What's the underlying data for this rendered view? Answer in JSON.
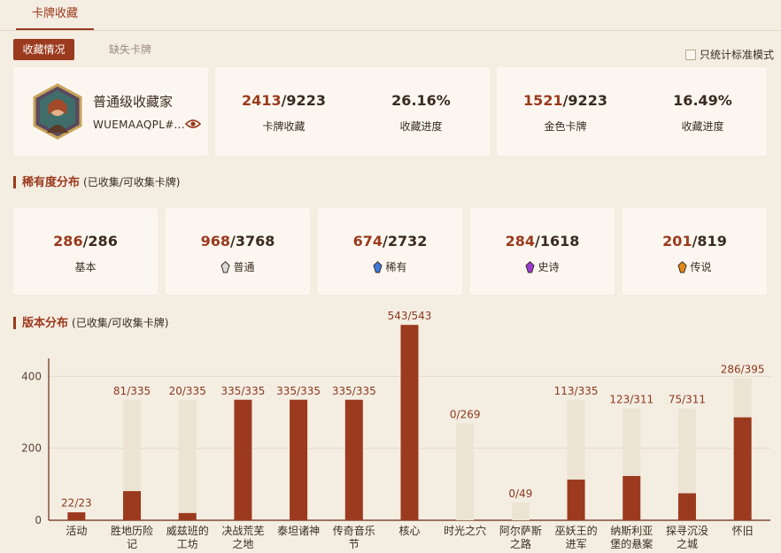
{
  "tabs": {
    "main": "卡牌收藏"
  },
  "subtabs": {
    "active": "收藏情况",
    "other": "缺失卡牌"
  },
  "std_mode_label": "只统计标准模式",
  "profile": {
    "name": "普通级收藏家",
    "uid": "WUEMAAQPL#..."
  },
  "totals": {
    "collected": "2413",
    "total": "/9223",
    "collected_label": "卡牌收藏",
    "progress": "26.16%",
    "progress_label": "收藏进度",
    "gold": "1521",
    "gold_total": "/9223",
    "gold_label": "金色卡牌",
    "gold_progress": "16.49%",
    "gold_progress_label": "收藏进度"
  },
  "rarity_title": "稀有度分布",
  "rarity_subtitle": "(已收集/可收集卡牌)",
  "rarity": [
    {
      "have": "286",
      "total": "/286",
      "label": "基本",
      "gem": "none"
    },
    {
      "have": "968",
      "total": "/3768",
      "label": "普通",
      "gem": "#d8d8d8"
    },
    {
      "have": "674",
      "total": "/2732",
      "label": "稀有",
      "gem": "#3f7be0"
    },
    {
      "have": "284",
      "total": "/1618",
      "label": "史诗",
      "gem": "#9b3bd6"
    },
    {
      "have": "201",
      "total": "/819",
      "label": "传说",
      "gem": "#e48a1a"
    }
  ],
  "version_title": "版本分布",
  "version_subtitle": "(已收集/可收集卡牌)",
  "colors": {
    "accent": "#9b3a1e",
    "bar_bg": "#ece3d3"
  },
  "chart_data": {
    "type": "bar",
    "ylim": [
      0,
      450
    ],
    "yticks": [
      0,
      200,
      400
    ],
    "categories": [
      "活动",
      "胜地历险记",
      "威兹班的工坊",
      "决战荒芜之地",
      "泰坦诸神",
      "传奇音乐节",
      "核心",
      "时光之穴",
      "阿尔萨斯之路",
      "巫妖王的进军",
      "纳斯利亚堡的悬案",
      "探寻沉没之城",
      "怀旧"
    ],
    "category_lines": [
      [
        "活动"
      ],
      [
        "胜地历险",
        "记"
      ],
      [
        "威兹班的",
        "工坊"
      ],
      [
        "决战荒芜",
        "之地"
      ],
      [
        "泰坦诸神"
      ],
      [
        "传奇音乐",
        "节"
      ],
      [
        "核心"
      ],
      [
        "时光之穴"
      ],
      [
        "阿尔萨斯",
        "之路"
      ],
      [
        "巫妖王的",
        "进军"
      ],
      [
        "纳斯利亚",
        "堡的悬案"
      ],
      [
        "探寻沉没",
        "之城"
      ],
      [
        "怀旧"
      ]
    ],
    "series": [
      {
        "name": "已收集",
        "values": [
          22,
          81,
          20,
          335,
          335,
          335,
          543,
          0,
          0,
          113,
          123,
          75,
          286
        ]
      },
      {
        "name": "可收集",
        "values": [
          23,
          335,
          335,
          335,
          335,
          335,
          543,
          269,
          49,
          335,
          311,
          311,
          395
        ]
      }
    ],
    "data_labels": [
      "22/23",
      "81/335",
      "20/335",
      "335/335",
      "335/335",
      "335/335",
      "543/543",
      "0/269",
      "0/49",
      "113/335",
      "123/311",
      "75/311",
      "286/395"
    ]
  }
}
